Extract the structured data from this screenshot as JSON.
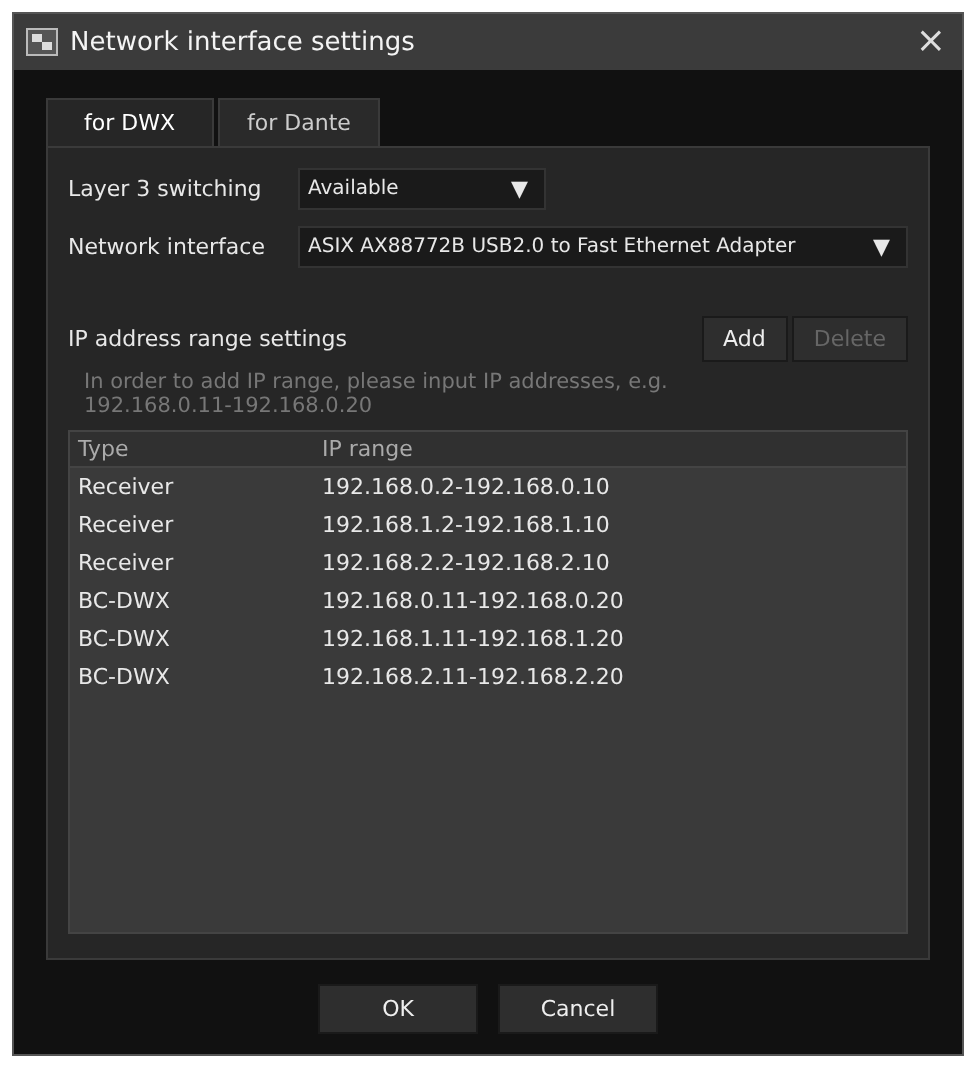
{
  "window": {
    "title": "Network interface settings",
    "close": "×"
  },
  "tabs": [
    {
      "label": "for DWX",
      "selected": true
    },
    {
      "label": "for Dante",
      "selected": false
    }
  ],
  "layer3": {
    "label": "Layer 3 switching",
    "value": "Available",
    "arrow": "▼"
  },
  "network_interface": {
    "label": "Network interface",
    "value": "ASIX AX88772B USB2.0 to Fast Ethernet Adapter",
    "arrow": "▼"
  },
  "ip_range": {
    "title": "IP address range settings",
    "buttons": [
      {
        "label": "Add",
        "disabled": false
      },
      {
        "label": "Delete",
        "disabled": true
      }
    ],
    "hint": "In order to add IP range, please input IP addresses, e.g.\n192.168.0.11-192.168.0.20"
  },
  "table": {
    "columns": [
      "Type",
      "IP range"
    ],
    "rows": [
      [
        "Receiver",
        "192.168.0.2-192.168.0.10"
      ],
      [
        "Receiver",
        "192.168.1.2-192.168.1.10"
      ],
      [
        "Receiver",
        "192.168.2.2-192.168.2.10"
      ],
      [
        "BC-DWX",
        "192.168.0.11-192.168.0.20"
      ],
      [
        "BC-DWX",
        "192.168.1.11-192.168.1.20"
      ],
      [
        "BC-DWX",
        "192.168.2.11-192.168.2.20"
      ]
    ]
  },
  "buttons": [
    "OK",
    "Cancel"
  ]
}
